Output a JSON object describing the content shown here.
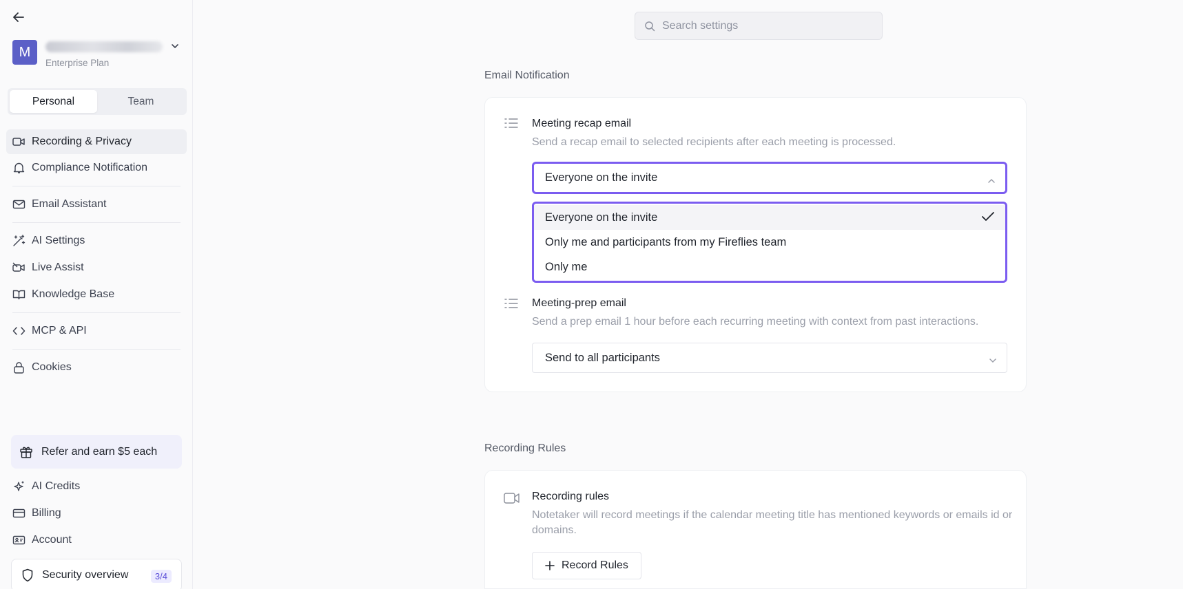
{
  "account": {
    "avatar_letter": "M",
    "plan": "Enterprise Plan"
  },
  "scope_tabs": [
    "Personal",
    "Team"
  ],
  "nav": {
    "recording_privacy": "Recording & Privacy",
    "compliance": "Compliance Notification",
    "email_assistant": "Email Assistant",
    "ai_settings": "AI Settings",
    "live_assist": "Live Assist",
    "knowledge_base": "Knowledge Base",
    "mcp_api": "MCP & API",
    "cookies": "Cookies"
  },
  "refer_label": "Refer and earn $5 each",
  "bottom_nav": {
    "ai_credits": "AI Credits",
    "billing": "Billing",
    "account": "Account"
  },
  "security": {
    "label": "Security overview",
    "progress": "3/4"
  },
  "search": {
    "placeholder": "Search settings"
  },
  "email_section": {
    "title": "Email Notification",
    "recap": {
      "title": "Meeting recap email",
      "description": "Send a recap email to selected recipients after each meeting is processed.",
      "selected": "Everyone on the invite",
      "options": [
        "Everyone on the invite",
        "Only me and participants from my Fireflies team",
        "Only me"
      ]
    },
    "prep": {
      "title": "Meeting-prep email",
      "description": "Send a prep email 1 hour before each recurring meeting with context from past interactions.",
      "selected": "Send to all participants"
    }
  },
  "recording_section": {
    "title": "Recording Rules",
    "rules": {
      "title": "Recording rules",
      "description": "Notetaker will record meetings if the calendar meeting title has mentioned keywords or emails id or domains.",
      "button": "Record Rules"
    }
  },
  "colors": {
    "accent": "#7b5cf0",
    "avatar": "#5b5fc7"
  }
}
